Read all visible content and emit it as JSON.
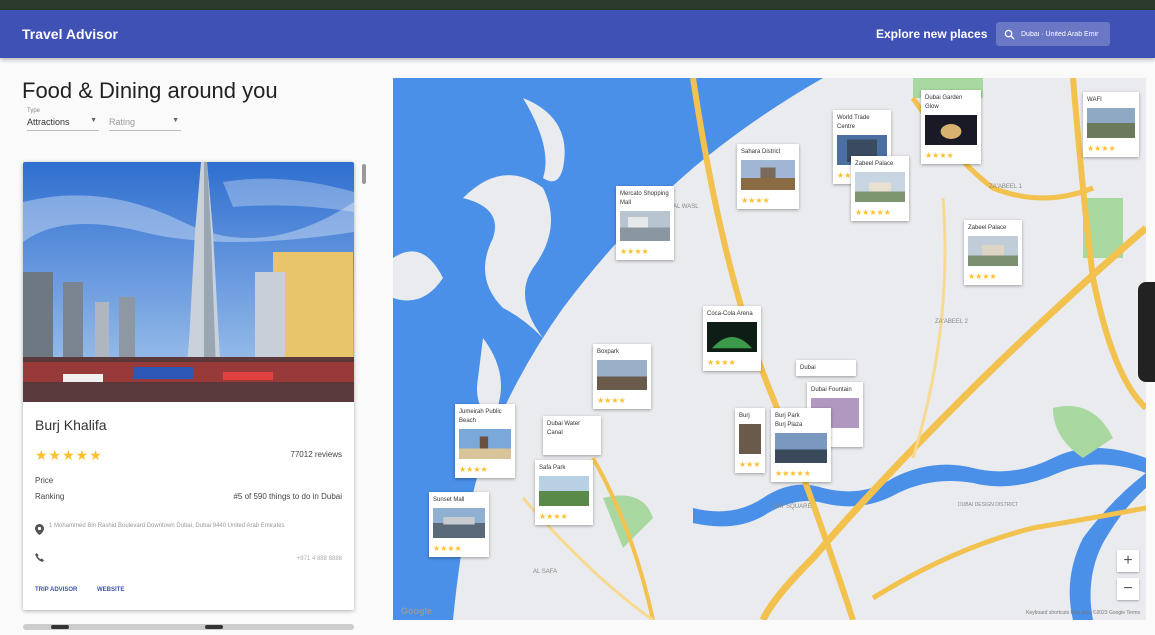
{
  "app": {
    "title": "Travel Advisor"
  },
  "header": {
    "explore_label": "Explore new places",
    "search_value": "Dubai · United Arab Emir"
  },
  "page": {
    "heading": "Food & Dining around you",
    "type_label": "Type",
    "type_value": "Attractions",
    "rating_value": "Rating"
  },
  "card": {
    "name": "Burj Khalifa",
    "stars": "★★★★★",
    "reviews": "77012 reviews",
    "price_label": "Price",
    "ranking_label": "Ranking",
    "ranking_value": "#5 of 590 things to do in Dubai",
    "address": "1 Mohammed Bin Rashid Boulevard Downtown Dubai, Dubai 9440 United Arab Emirates",
    "phone": "+971 4 888 8888",
    "advisor_button": "TRIP ADVISOR",
    "website_button": "WEBSITE"
  },
  "map": {
    "zoom_in": "+",
    "zoom_out": "−",
    "logo": "Google",
    "attribution": "Keyboard shortcuts   Map data ©2023 Google   Terms",
    "labels": [
      "AL SAFA",
      "ZA'ABEEL 1",
      "ZA'ABEEL 2",
      "BAY SQUARE",
      "DUBAI DESIGN DISTRICT",
      "AL WASL"
    ],
    "places": [
      {
        "name": "Mercato Shopping Mall",
        "stars": "★★★★"
      },
      {
        "name": "Sahara District",
        "stars": "★★★★"
      },
      {
        "name": "World Trade Centre",
        "stars": "★★★★"
      },
      {
        "name": "Zabeel Palace",
        "stars": "★★★★★"
      },
      {
        "name": "Dubai Garden Glow",
        "stars": "★★★★"
      },
      {
        "name": "WAFI",
        "stars": "★★★★"
      },
      {
        "name": "Zabeel Palace",
        "stars": "★★★★"
      },
      {
        "name": "Coca-Cola Arena",
        "stars": "★★★★"
      },
      {
        "name": "Boxpark",
        "stars": "★★★★"
      },
      {
        "name": "Jumeirah Public Beach",
        "stars": "★★★★"
      },
      {
        "name": "Dubai Water Canal",
        "stars": "★★★★"
      },
      {
        "name": "Safa Park",
        "stars": "★★★★"
      },
      {
        "name": "Sunset Mall",
        "stars": "★★★★"
      },
      {
        "name": "Burj Park",
        "stars": "★★★★★"
      },
      {
        "name": "Dubai Fountain",
        "stars": "★★★"
      },
      {
        "name": "Dubai",
        "stars": ""
      },
      {
        "name": "Burj Plaza",
        "stars": "★★★★★"
      },
      {
        "name": "Burj",
        "stars": "★★★"
      }
    ]
  },
  "colors": {
    "appbar": "#3f51b5",
    "water": "#4a8fe8",
    "road": "#f2c14e",
    "stars": "#fbc02d"
  }
}
